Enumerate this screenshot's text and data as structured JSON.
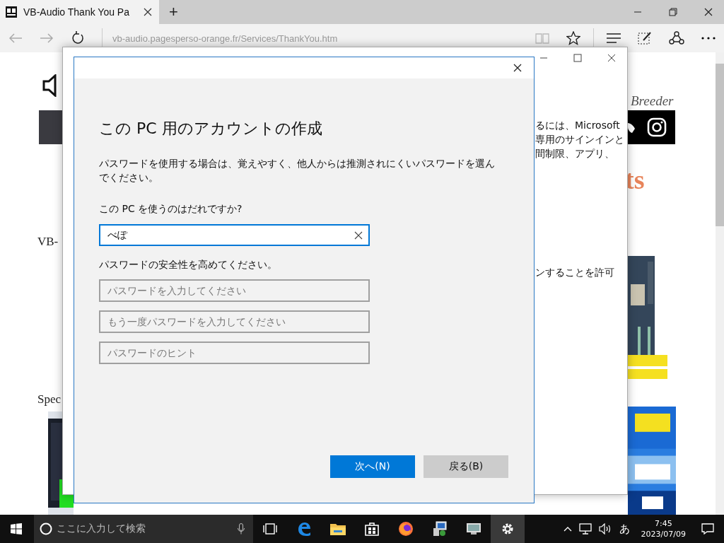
{
  "browser": {
    "tab_title": "VB-Audio Thank You Pa",
    "new_tab": "+",
    "url_host": "vb-audio.pagesperso-orange.fr",
    "url_path": "/Services/ThankYou.htm"
  },
  "web_page": {
    "left_texts": [
      "VB-",
      "Spec"
    ],
    "script_text": "Breeder",
    "heading_fragment": "ts"
  },
  "settings_window": {
    "text_lines": [
      "るには、Microsoft",
      "専用のサインインと",
      "間制限、アプリ、"
    ],
    "text_line_lower": "ンすることを許可"
  },
  "dialog": {
    "title": "この PC 用のアカウントの作成",
    "description": "パスワードを使用する場合は、覚えやすく、他人からは推測されにくいパスワードを選んでください。",
    "name_label": "この PC を使うのはだれですか?",
    "name_value": "べぽ",
    "password_label": "パスワードの安全性を高めてください。",
    "password_fields": [
      {
        "placeholder": "パスワードを入力してください"
      },
      {
        "placeholder": "もう一度パスワードを入力してください"
      },
      {
        "placeholder": "パスワードのヒント"
      }
    ],
    "buttons": [
      {
        "label": "次へ(N)",
        "kind": "primary"
      },
      {
        "label": "戻る(B)",
        "kind": "secondary"
      }
    ]
  },
  "taskbar": {
    "search_placeholder": "ここに入力して検索",
    "apps": [
      {
        "kind": "taskview",
        "active": false
      },
      {
        "kind": "edge",
        "active": false
      },
      {
        "kind": "folder",
        "active": false
      },
      {
        "kind": "store",
        "active": false
      },
      {
        "kind": "firefox",
        "active": false
      },
      {
        "kind": "installer",
        "active": false
      },
      {
        "kind": "monitor",
        "active": false
      },
      {
        "kind": "settings",
        "active": true
      }
    ],
    "ime": "あ",
    "time": "7:45",
    "date": "2023/07/09"
  }
}
